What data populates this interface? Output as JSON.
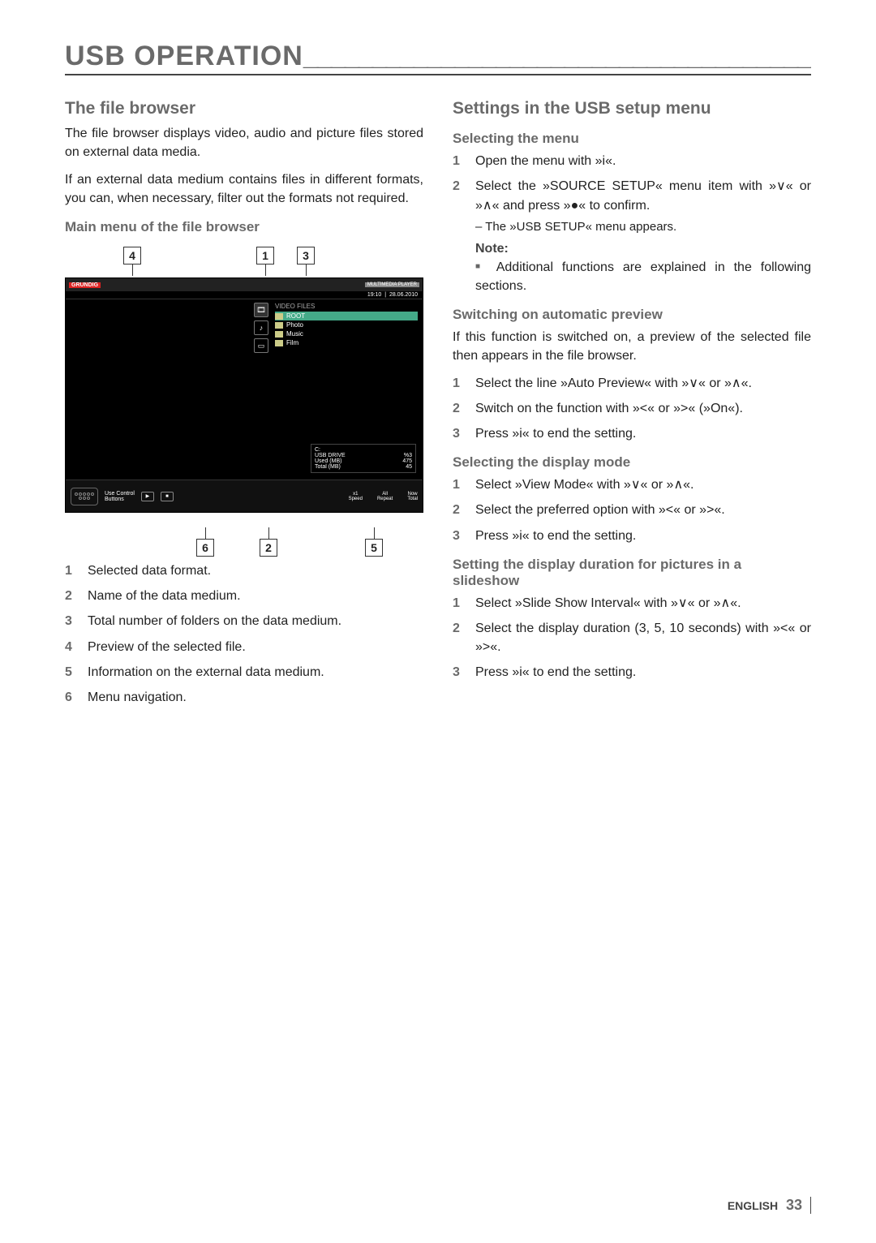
{
  "page": {
    "title_text": "USB OPERATION",
    "title_trail": "______________________________________",
    "language": "ENGLISH",
    "number": "33"
  },
  "left": {
    "h_file_browser": "The file browser",
    "p1": "The file browser displays video, audio and picture files stored on external data media.",
    "p2": "If an external data medium contains files in different formats, you can, when necessary, filter out the formats not required.",
    "h_mainmenu": "Main menu of the file browser",
    "callouts_top": {
      "c4": "4",
      "c1": "1",
      "c3": "3"
    },
    "callouts_bot": {
      "c6": "6",
      "c2": "2",
      "c5": "5"
    },
    "shot": {
      "brand": "GRUNDIG",
      "product": "MULTIMEDIA PLAYER",
      "time": "19:10",
      "date": "28.06.2010",
      "files_title": "VIDEO FILES",
      "rows": [
        "ROOT",
        "Photo",
        "Music",
        "Film"
      ],
      "drive_title": "C:",
      "drive_name": "USB DRIVE",
      "used_label": "Used (MB)",
      "total_label": "Total (MB)",
      "pct": "%3",
      "used": "475",
      "total": "45",
      "foot_use": "Use Control",
      "foot_btns": "Buttons",
      "speed_lbl": "Speed",
      "speed_val": "x1",
      "repeat_lbl": "Repeat",
      "repeat_val": "All",
      "now_lbl": "Total",
      "now_val": "Now"
    },
    "legend": [
      "Selected data format.",
      "Name of the data medium.",
      "Total number of folders on the data medium.",
      "Preview of the selected file.",
      "Information on the external data medium.",
      "Menu navigation."
    ]
  },
  "right": {
    "h_settings": "Settings in the USB setup menu",
    "h_selmenu": "Selecting the menu",
    "selmenu_steps": [
      "Open the menu with »i«.",
      "Select the »SOURCE SETUP« menu item with »∨« or »∧« and press »●« to confirm."
    ],
    "selmenu_sub": "The »USB SETUP« menu appears.",
    "note_title": "Note:",
    "note_body": "Additional functions are explained in the following sections.",
    "h_autoprev": "Switching on automatic preview",
    "autoprev_intro": "If this function is switched on, a preview of the selected file then appears in the file browser.",
    "autoprev_steps": [
      "Select the line »Auto Preview« with »∨« or »∧«.",
      "Switch on the function with »<« or »>« (»On«).",
      "Press »i« to end the setting."
    ],
    "h_dispmode": "Selecting the display mode",
    "dispmode_steps": [
      "Select »View Mode« with »∨« or »∧«.",
      "Select the preferred option with »<« or »>«.",
      "Press »i« to end the setting."
    ],
    "h_slideshow": "Setting the display duration for pictures in a slideshow",
    "slideshow_steps": [
      "Select »Slide Show Interval« with »∨« or »∧«.",
      "Select the display duration (3, 5, 10 seconds) with »<« or »>«.",
      "Press »i« to end the setting."
    ]
  }
}
